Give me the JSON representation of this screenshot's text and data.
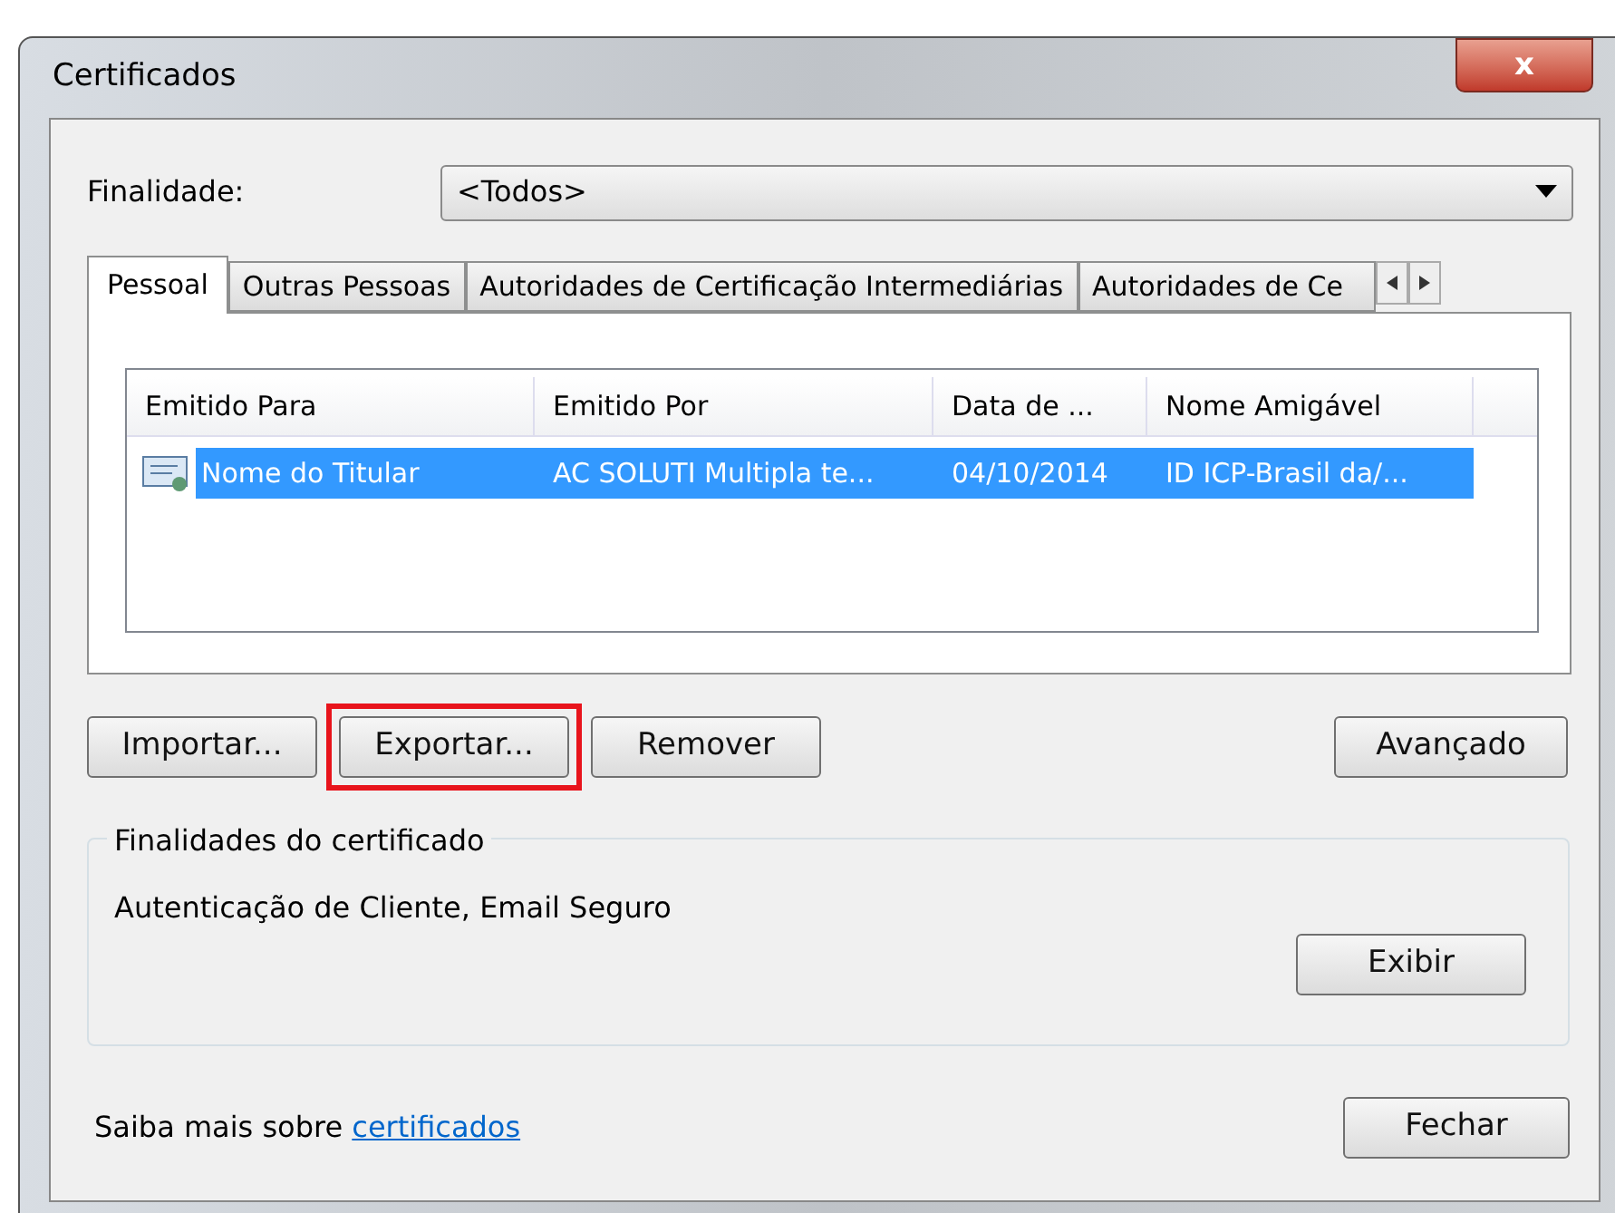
{
  "window": {
    "title": "Certificados",
    "close": "x"
  },
  "purpose": {
    "label": "Finalidade:",
    "value": "<Todos>"
  },
  "tabs": [
    {
      "label": "Pessoal",
      "selected": true
    },
    {
      "label": "Outras Pessoas",
      "selected": false
    },
    {
      "label": "Autoridades de Certificação Intermediárias",
      "selected": false
    },
    {
      "label": "Autoridades de Ce",
      "selected": false
    }
  ],
  "table": {
    "columns": [
      "Emitido Para",
      "Emitido Por",
      "Data de ...",
      "Nome Amigável"
    ],
    "rows": [
      {
        "cells": [
          "Nome do Titular",
          "AC SOLUTI Multipla te...",
          "04/10/2014",
          "ID ICP-Brasil da/..."
        ],
        "selected": true
      }
    ]
  },
  "buttons": [
    {
      "label": "Importar...",
      "highlighted": false
    },
    {
      "label": "Exportar...",
      "highlighted": true
    },
    {
      "label": "Remover",
      "highlighted": false
    }
  ],
  "advanced_button": "Avançado",
  "purposes_group": {
    "title": "Finalidades do certificado",
    "text": "Autenticação de Cliente, Email Seguro",
    "button": "Exibir"
  },
  "footer": {
    "text": "Saiba mais sobre",
    "link": "certificados",
    "button": "Fechar"
  }
}
